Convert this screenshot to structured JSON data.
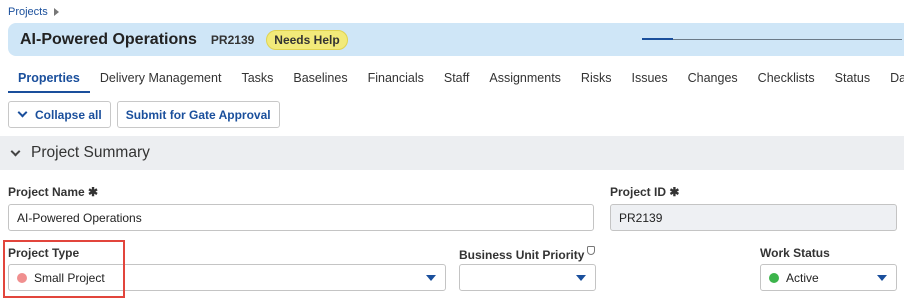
{
  "breadcrumb": {
    "label": "Projects"
  },
  "header": {
    "title": "AI-Powered Operations",
    "project_id": "PR2139",
    "status_badge": "Needs Help",
    "progress_fraction": 0.12
  },
  "tabs": [
    {
      "label": "Properties",
      "active": true
    },
    {
      "label": "Delivery Management"
    },
    {
      "label": "Tasks"
    },
    {
      "label": "Baselines"
    },
    {
      "label": "Financials"
    },
    {
      "label": "Staff"
    },
    {
      "label": "Assignments"
    },
    {
      "label": "Risks"
    },
    {
      "label": "Issues"
    },
    {
      "label": "Changes"
    },
    {
      "label": "Checklists"
    },
    {
      "label": "Status"
    },
    {
      "label": "Das"
    }
  ],
  "toolbar": {
    "collapse_label": "Collapse all",
    "submit_label": "Submit for Gate Approval"
  },
  "section": {
    "title": "Project Summary"
  },
  "fields": {
    "project_name": {
      "label": "Project Name ✱",
      "value": "AI-Powered Operations"
    },
    "project_id": {
      "label": "Project ID ✱",
      "value": "PR2139"
    },
    "project_type": {
      "label": "Project Type",
      "value": "Small Project",
      "dot_color": "#f08f8f"
    },
    "business_unit_priority": {
      "label": "Business Unit Priority",
      "value": ""
    },
    "work_status": {
      "label": "Work Status",
      "value": "Active",
      "dot_color": "#3cb44b"
    }
  },
  "colors": {
    "accent": "#1a4f9c",
    "header_bg": "#cfe6f7",
    "badge_bg": "#f2ea7a",
    "highlight": "#e2453c"
  }
}
